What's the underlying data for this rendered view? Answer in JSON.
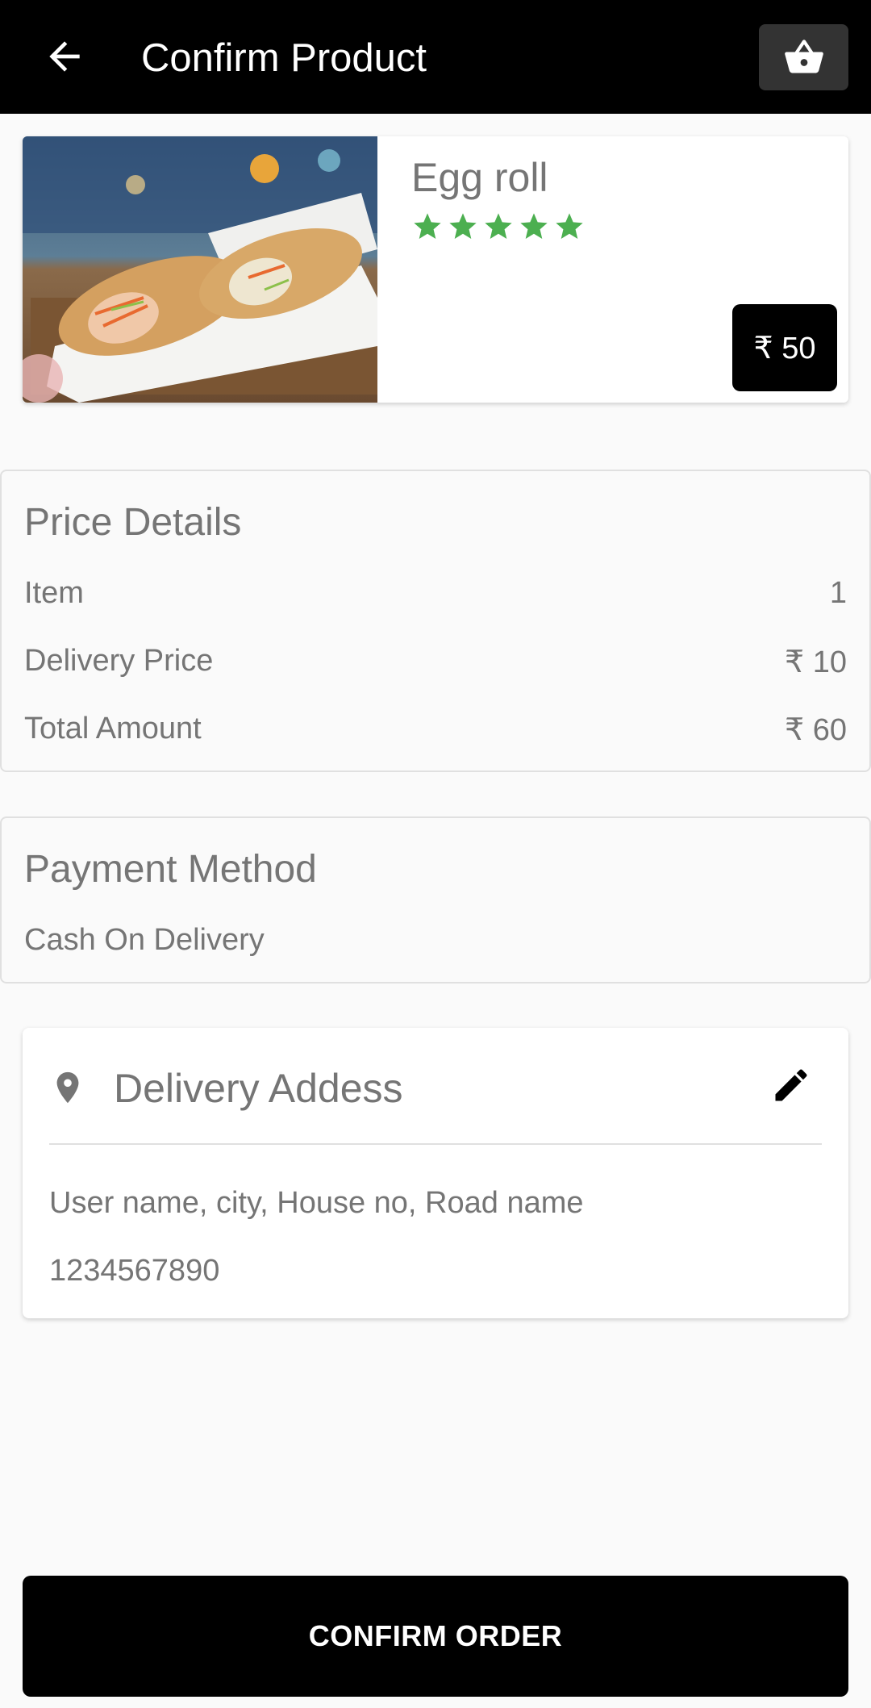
{
  "appbar": {
    "title": "Confirm Product",
    "back_icon": "arrow-back-icon",
    "cart_icon": "shopping-basket-icon"
  },
  "product": {
    "name": "Egg roll",
    "rating_stars": 5,
    "star_color": "#4caf50",
    "price": "₹ 50"
  },
  "price_details": {
    "title": "Price Details",
    "rows": [
      {
        "label": "Item",
        "value": "1"
      },
      {
        "label": "Delivery Price",
        "value": "₹ 10"
      },
      {
        "label": "Total Amount",
        "value": "₹ 60"
      }
    ]
  },
  "payment": {
    "title": "Payment Method",
    "method": "Cash On Delivery"
  },
  "address": {
    "title": "Delivery Addess",
    "location_icon": "location-pin-icon",
    "edit_icon": "edit-pencil-icon",
    "line1": "User name, city, House no, Road name",
    "phone": "1234567890"
  },
  "confirm_button": {
    "label": "CONFIRM ORDER"
  }
}
